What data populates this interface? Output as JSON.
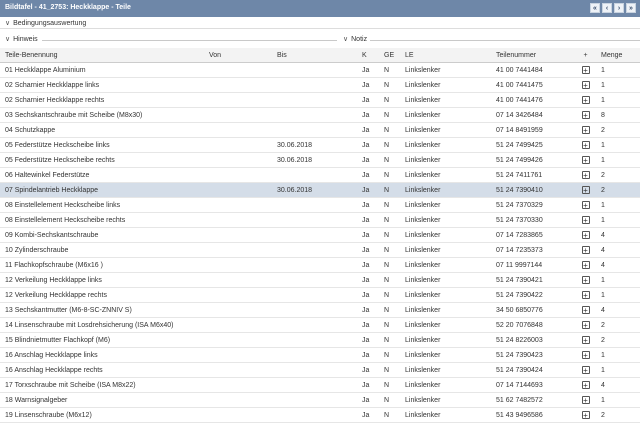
{
  "titlebar": {
    "title": "Bildtafel - 41_2753: Heckklappe - Teile",
    "nav": [
      "«",
      "‹",
      "›",
      "»"
    ]
  },
  "sections": {
    "condition": "Bedingungsauswertung",
    "hint": "Hinweis",
    "note": "Notiz"
  },
  "table": {
    "headers": [
      "Teile-Benennung",
      "Von",
      "Bis",
      "K",
      "GE",
      "LE",
      "Teilenummer",
      "+",
      "Menge"
    ],
    "rows": [
      [
        "01 Heckklappe Aluminium",
        "",
        "",
        "Ja",
        "N",
        "Linkslenker",
        "41 00 7441484",
        "1"
      ],
      [
        "02 Scharnier Heckklappe links",
        "",
        "",
        "Ja",
        "N",
        "Linkslenker",
        "41 00 7441475",
        "1"
      ],
      [
        "02 Scharnier Heckklappe rechts",
        "",
        "",
        "Ja",
        "N",
        "Linkslenker",
        "41 00 7441476",
        "1"
      ],
      [
        "03 Sechskantschraube mit Scheibe (M8x30)",
        "",
        "",
        "Ja",
        "N",
        "Linkslenker",
        "07 14 3426484",
        "8"
      ],
      [
        "04 Schutzkappe",
        "",
        "",
        "Ja",
        "N",
        "Linkslenker",
        "07 14 8491959",
        "2"
      ],
      [
        "05 Federstütze Heckscheibe links",
        "",
        "30.06.2018",
        "Ja",
        "N",
        "Linkslenker",
        "51 24 7499425",
        "1"
      ],
      [
        "05 Federstütze Heckscheibe rechts",
        "",
        "30.06.2018",
        "Ja",
        "N",
        "Linkslenker",
        "51 24 7499426",
        "1"
      ],
      [
        "06 Haltewinkel Federstütze",
        "",
        "",
        "Ja",
        "N",
        "Linkslenker",
        "51 24 7411761",
        "2"
      ],
      [
        "07 Spindelantrieb Heckklappe",
        "",
        "30.06.2018",
        "Ja",
        "N",
        "Linkslenker",
        "51 24 7390410",
        "2"
      ],
      [
        "08 Einstellelement Heckscheibe links",
        "",
        "",
        "Ja",
        "N",
        "Linkslenker",
        "51 24 7370329",
        "1"
      ],
      [
        "08 Einstellelement Heckscheibe rechts",
        "",
        "",
        "Ja",
        "N",
        "Linkslenker",
        "51 24 7370330",
        "1"
      ],
      [
        "09 Kombi-Sechskantschraube",
        "",
        "",
        "Ja",
        "N",
        "Linkslenker",
        "07 14 7283865",
        "4"
      ],
      [
        "10 Zylinderschraube",
        "",
        "",
        "Ja",
        "N",
        "Linkslenker",
        "07 14 7235373",
        "4"
      ],
      [
        "11 Flachkopfschraube (M6x16 )",
        "",
        "",
        "Ja",
        "N",
        "Linkslenker",
        "07 11 9997144",
        "4"
      ],
      [
        "12 Verkeilung Heckklappe links",
        "",
        "",
        "Ja",
        "N",
        "Linkslenker",
        "51 24 7390421",
        "1"
      ],
      [
        "12 Verkeilung Heckklappe rechts",
        "",
        "",
        "Ja",
        "N",
        "Linkslenker",
        "51 24 7390422",
        "1"
      ],
      [
        "13 Sechskantmutter (M6-8-SC-ZNNIV S)",
        "",
        "",
        "Ja",
        "N",
        "Linkslenker",
        "34 50 6850776",
        "4"
      ],
      [
        "14 Linsenschraube mit Losdrehsicherung (ISA M6x40)",
        "",
        "",
        "Ja",
        "N",
        "Linkslenker",
        "52 20 7076848",
        "2"
      ],
      [
        "15 Blindnietmutter Flachkopf (M6)",
        "",
        "",
        "Ja",
        "N",
        "Linkslenker",
        "51 24 8226003",
        "2"
      ],
      [
        "16 Anschlag Heckklappe links",
        "",
        "",
        "Ja",
        "N",
        "Linkslenker",
        "51 24 7390423",
        "1"
      ],
      [
        "16 Anschlag Heckklappe rechts",
        "",
        "",
        "Ja",
        "N",
        "Linkslenker",
        "51 24 7390424",
        "1"
      ],
      [
        "17 Torxschraube mit Scheibe (ISA M8x22)",
        "",
        "",
        "Ja",
        "N",
        "Linkslenker",
        "07 14 7144693",
        "4"
      ],
      [
        "18 Warnsignalgeber",
        "",
        "",
        "Ja",
        "N",
        "Linkslenker",
        "51 62 7482572",
        "1"
      ],
      [
        "19 Linsenschraube (M6x12)",
        "",
        "",
        "Ja",
        "N",
        "Linkslenker",
        "51 43 9496586",
        "2"
      ]
    ],
    "selected_row": 8
  }
}
